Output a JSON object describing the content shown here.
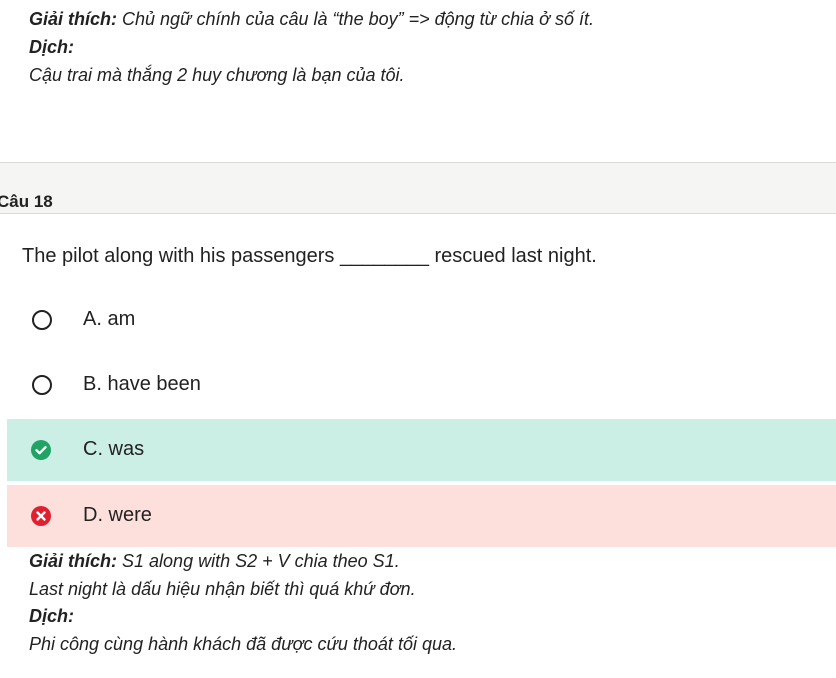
{
  "top_explanation": {
    "label": "Giải thích:",
    "text": " Chủ ngữ chính của câu là “the boy” => động từ chia ở số ít.",
    "translation_label": "Dịch:",
    "translation": "Cậu trai mà thắng 2 huy chương là bạn của tôi."
  },
  "question": {
    "header": "Câu 18",
    "text": "The pilot along with his passengers ________ rescued last night.",
    "options": [
      {
        "label": "A. am",
        "state": "unselected"
      },
      {
        "label": "B. have been",
        "state": "unselected"
      },
      {
        "label": "C. was",
        "state": "correct",
        "icon": "check-circle-icon"
      },
      {
        "label": "D. were",
        "state": "wrong",
        "icon": "x-circle-icon"
      }
    ]
  },
  "explanation": {
    "label": "Giải thích:",
    "line1": " S1 along with S2 + V chia theo S1.",
    "line2": "Last night là dấu hiệu nhận biết thì quá khứ đơn.",
    "translation_label": "Dịch:",
    "translation": "Phi công cùng hành khách đã được cứu thoát tối qua."
  },
  "colors": {
    "correct_bg": "#cbeee5",
    "wrong_bg": "#fde0db",
    "correct_icon": "#21a366",
    "wrong_icon": "#e0202f"
  }
}
